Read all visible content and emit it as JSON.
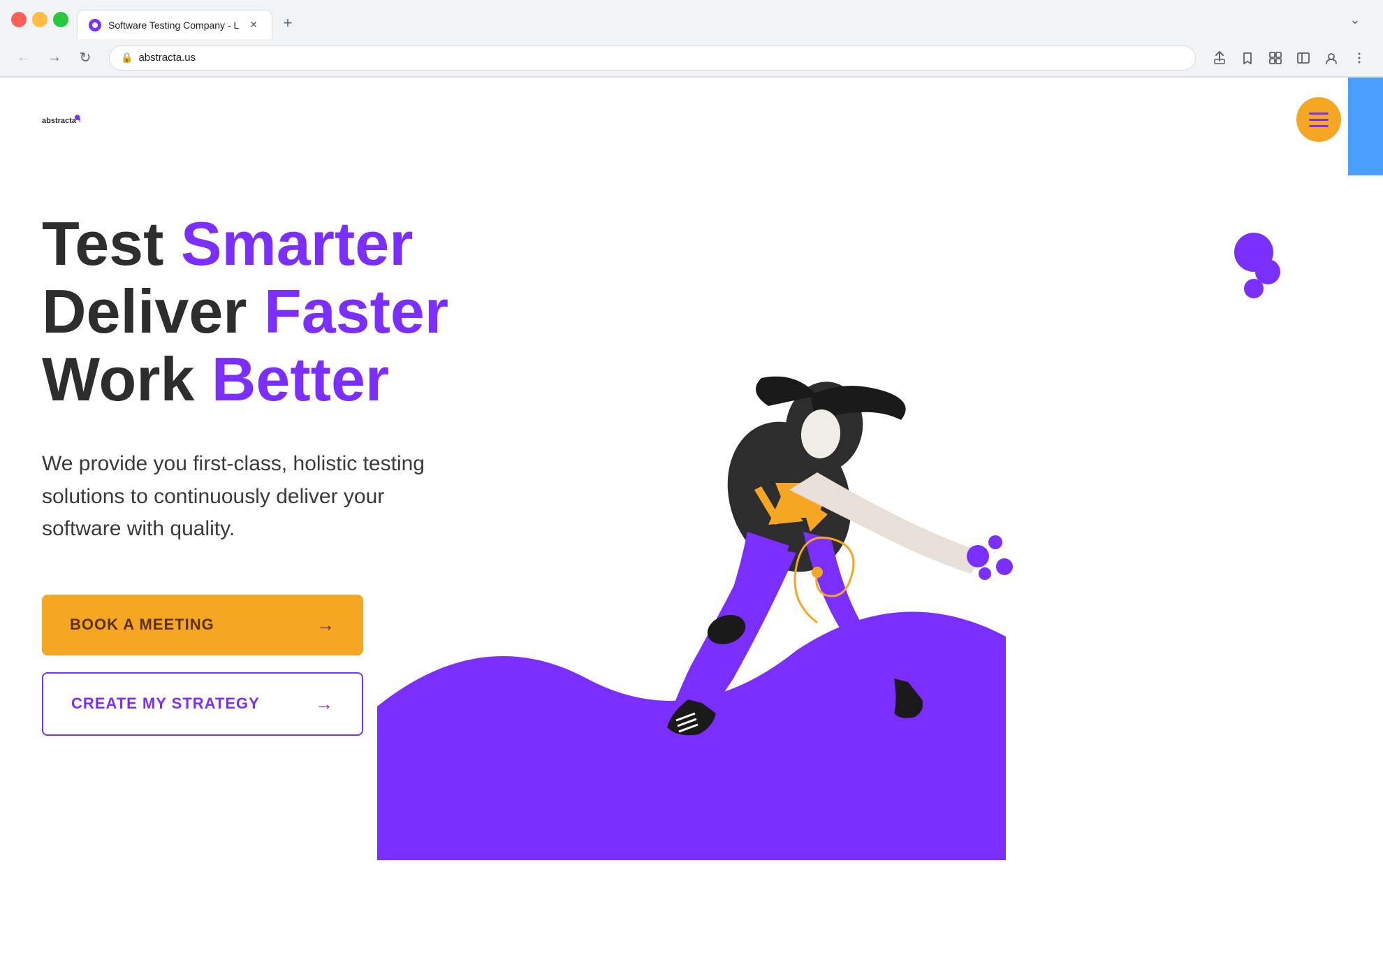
{
  "browser": {
    "tab_title": "Software Testing Company - L",
    "url": "abstracta.us",
    "favicon_color": "#7b2fff"
  },
  "nav": {
    "back_label": "←",
    "forward_label": "→",
    "reload_label": "↻",
    "lock_icon": "🔒",
    "share_icon": "⬆",
    "bookmark_icon": "☆",
    "extensions_icon": "🧩",
    "sidebar_icon": "▣",
    "profile_icon": "👤",
    "more_icon": "⋮",
    "chevron_down": "⌄",
    "new_tab": "+"
  },
  "site": {
    "logo_text": "abstracta",
    "menu_button_label": "menu",
    "headline_line1_normal": "Test ",
    "headline_line1_purple": "Smarter",
    "headline_line2_normal": "Deliver ",
    "headline_line2_purple": "Faster",
    "headline_line3_normal": "Work ",
    "headline_line3_purple": "Better",
    "description": "We provide you first-class, holistic testing solutions to continuously deliver your software with quality.",
    "cta_primary": "BOOK A MEETING",
    "cta_secondary": "CREATE MY STRATEGY",
    "arrow": "→"
  },
  "colors": {
    "purple": "#7b2fff",
    "orange": "#f5a623",
    "dark_text": "#2d2d2d",
    "body_text": "#3a3a3a",
    "blue_accent": "#4a9eff",
    "white": "#ffffff"
  }
}
